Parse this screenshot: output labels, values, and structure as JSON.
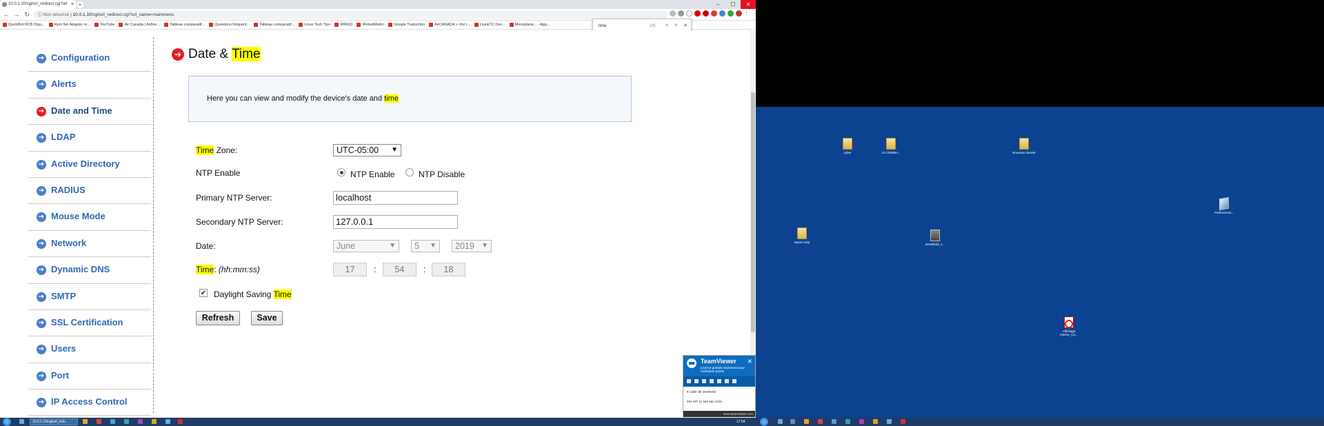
{
  "browser": {
    "tab_title": "10.0.1.10/cgi/url_redirect.cgi?url",
    "new_tab": "+",
    "url_security": "Non sécurisé",
    "url_host": "10.0.1.10",
    "url_path": "/cgi/url_redirect.cgi?url_name=mainmenu",
    "bookmarks": [
      "QuickBot RCB Disp...",
      "Rpm fan Adapter re...",
      "YouTube",
      "Air Canada | Airline...",
      "Tableau comparatif...",
      "Questions fréquent...",
      "Tableau comparatif...",
      "Linux Tech Tips",
      "WIRED",
      "WebsitMetric",
      "Google Traduction",
      "AirCANADA » Vivi l...",
      "Live&TC Des...",
      "Monoplane... - App..."
    ],
    "find": {
      "query": "time",
      "count": "1/5",
      "prev": "˄",
      "next": "˅",
      "close": "✕"
    }
  },
  "sidebar": {
    "items": [
      {
        "label": "Configuration",
        "active": false
      },
      {
        "label": "Alerts",
        "active": false
      },
      {
        "label": "Date and Time",
        "active": true
      },
      {
        "label": "LDAP",
        "active": false
      },
      {
        "label": "Active Directory",
        "active": false
      },
      {
        "label": "RADIUS",
        "active": false
      },
      {
        "label": "Mouse Mode",
        "active": false
      },
      {
        "label": "Network",
        "active": false
      },
      {
        "label": "Dynamic DNS",
        "active": false
      },
      {
        "label": "SMTP",
        "active": false
      },
      {
        "label": "SSL Certification",
        "active": false
      },
      {
        "label": "Users",
        "active": false
      },
      {
        "label": "Port",
        "active": false
      },
      {
        "label": "IP Access Control",
        "active": false
      }
    ]
  },
  "main": {
    "title_pre": "Date & ",
    "title_hl": "Time",
    "info_pre": "Here you can view and modify the device's date and ",
    "info_hl": "time",
    "tz_hl": "Time",
    "tz_rest": " Zone:",
    "tz_value": "UTC-05:00",
    "ntp_label": "NTP Enable",
    "ntp_on": "NTP Enable",
    "ntp_off": "NTP Disable",
    "primary_label": "Primary NTP Server:",
    "primary_value": "localhost",
    "secondary_label": "Secondary NTP Server:",
    "secondary_value": "127.0.0.1",
    "date_label": "Date:",
    "month": "June",
    "day": "5",
    "year": "2019",
    "time_hl": "Time",
    "time_rest": ": ",
    "time_fmt": "(hh:mm:ss)",
    "hh": "17",
    "mm": "54",
    "ss": "18",
    "colon": ":",
    "dst_pre": "Daylight Saving ",
    "dst_hl": "Time",
    "dst_checked": true,
    "refresh": "Refresh",
    "save": "Save"
  },
  "teamviewer": {
    "name": "TeamViewer",
    "subtitle": "Licence gratuite seulement pour l'utilisation privée",
    "sessions": "Liste de sessions",
    "session_row": "981 497 11 569 562 3245",
    "footer": "www.teamviewer.com",
    "close": "✕"
  },
  "taskbar": {
    "active_item": "10.0.1.10/cgi/url_redi...",
    "clock": "17:54"
  },
  "desktop": {
    "icons": [
      "cyber",
      "c3 COMMA...",
      "Nouveau dossier",
      "Preferences...",
      "import victy",
      "20190529_1...",
      "Affichage interne_Co..."
    ]
  },
  "colors": {
    "accent": "#2e6ab4",
    "active": "#e02020",
    "highlight": "#ffff00",
    "desktop": "#0c4290"
  }
}
